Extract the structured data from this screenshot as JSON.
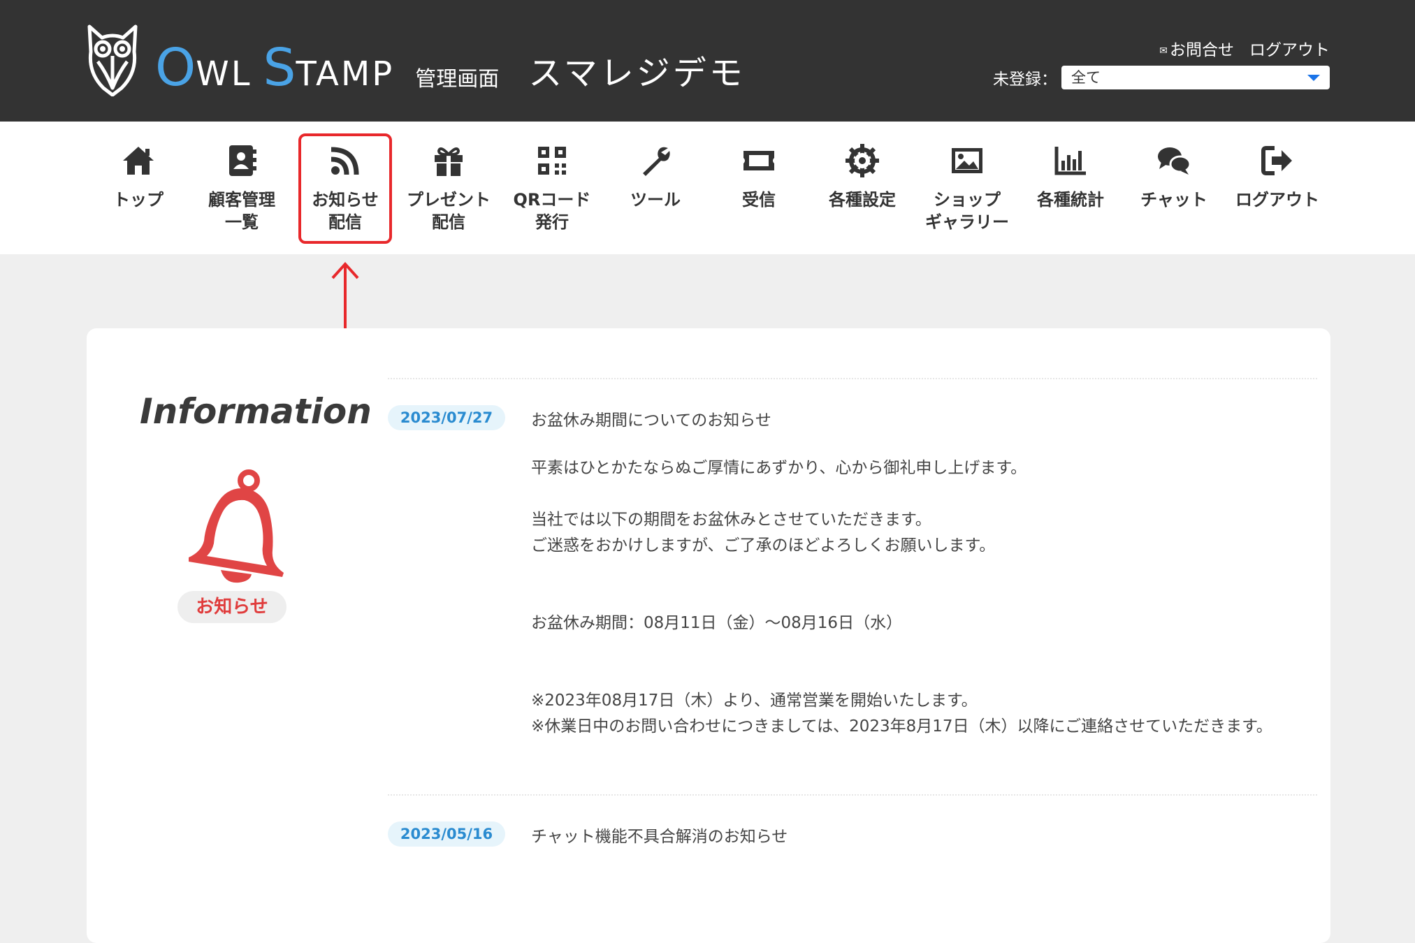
{
  "header": {
    "brand_o": "O",
    "brand_wl": "WL",
    "brand_s": "S",
    "brand_tamp": "TAMP",
    "brand_admin": "管理画面",
    "store_name": "スマレジデモ",
    "contact_label": "お問合せ",
    "logout_label": "ログアウト",
    "filter_label": "未登録：",
    "filter_value": "全て",
    "accent_color": "#4aa3e6"
  },
  "nav": {
    "items": [
      {
        "label": "トップ",
        "icon": "home-icon"
      },
      {
        "label": "顧客管理\n一覧",
        "icon": "address-book-icon"
      },
      {
        "label": "お知らせ\n配信",
        "icon": "rss-icon"
      },
      {
        "label": "プレゼント\n配信",
        "icon": "gift-icon"
      },
      {
        "label": "QRコード\n発行",
        "icon": "qr-code-icon"
      },
      {
        "label": "ツール",
        "icon": "wrench-icon"
      },
      {
        "label": "受信",
        "icon": "ticket-icon"
      },
      {
        "label": "各種設定",
        "icon": "gear-icon"
      },
      {
        "label": "ショップ\nギャラリー",
        "icon": "image-icon"
      },
      {
        "label": "各種統計",
        "icon": "bar-chart-icon"
      },
      {
        "label": "チャット",
        "icon": "chat-icon"
      },
      {
        "label": "ログアウト",
        "icon": "sign-out-icon"
      }
    ],
    "highlight_color": "#e8282b"
  },
  "info": {
    "title": "Information",
    "badge": "お知らせ",
    "badge_color": "#e03c3c"
  },
  "news": [
    {
      "date": "2023/07/27",
      "title": "お盆休み期間についてのお知らせ",
      "body": {
        "line1": "平素はひとかたならぬご厚情にあずかり、心から御礼申し上げます。",
        "line2": "当社では以下の期間をお盆休みとさせていただきます。",
        "line3": "ご迷惑をおかけしますが、ご了承のほどよろしくお願いします。",
        "line4": "お盆休み期間：08月11日（金）〜08月16日（水）",
        "line5": "※2023年08月17日（木）より、通常営業を開始いたします。",
        "line6": "※休業日中のお問い合わせにつきましては、2023年8月17日（木）以降にご連絡させていただきます。"
      }
    },
    {
      "date": "2023/05/16",
      "title": "チャット機能不具合解消のお知らせ"
    }
  ]
}
